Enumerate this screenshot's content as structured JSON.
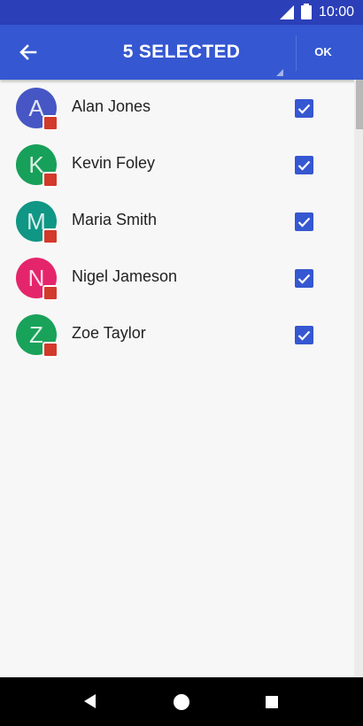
{
  "status_bar": {
    "time": "10:00"
  },
  "header": {
    "title": "5 SELECTED",
    "ok_label": "OK",
    "back_icon": "arrow-left-icon"
  },
  "contacts": [
    {
      "initial": "A",
      "name": "Alan Jones",
      "color": "#4656c4",
      "selected": true
    },
    {
      "initial": "K",
      "name": "Kevin Foley",
      "color": "#17a05a",
      "selected": true
    },
    {
      "initial": "M",
      "name": "Maria Smith",
      "color": "#0f9684",
      "selected": true
    },
    {
      "initial": "N",
      "name": "Nigel Jameson",
      "color": "#e5256b",
      "selected": true
    },
    {
      "initial": "Z",
      "name": "Zoe Taylor",
      "color": "#19a25a",
      "selected": true
    }
  ],
  "colors": {
    "status_bar": "#2b3fb8",
    "app_bar": "#3557d1",
    "checkbox": "#3557d1",
    "badge": "#d23a2c",
    "background": "#f7f7f7"
  }
}
